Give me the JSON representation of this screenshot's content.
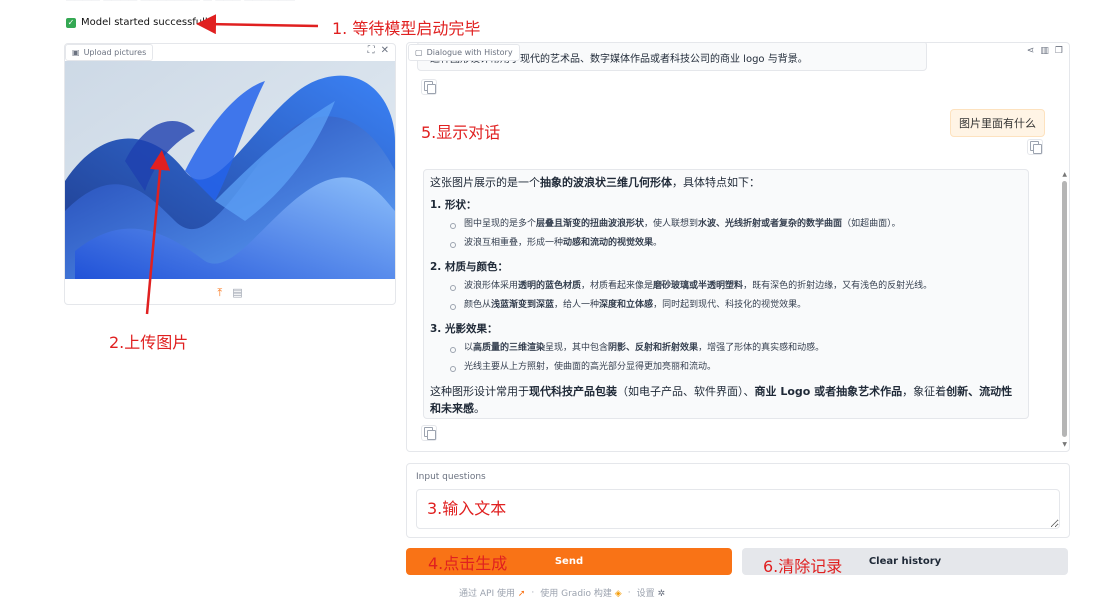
{
  "status": {
    "text": "Model started successfully"
  },
  "upload": {
    "label": "Upload pictures",
    "expand_icon": "fullscreen-icon",
    "close_icon": "close-icon"
  },
  "chat": {
    "label": "Dialogue with History",
    "prev_text": "这种图形设计常用于现代的艺术品、数字媒体作品或者科技公司的商业 logo 与背景。",
    "user_message": "图片里面有什么",
    "answer": {
      "intro_pre": "这张图片展示的是一个",
      "intro_bold": "抽象的波浪状三维几何形体",
      "intro_post": "，具体特点如下：",
      "sections": [
        {
          "title": "1. 形状：",
          "items": [
            [
              "图中呈现的是多个",
              "层叠且渐变的扭曲波浪形状",
              "，使人联想到",
              "水波、光线折射或者复杂的数学曲面",
              "（如超曲面）。"
            ],
            [
              "波浪互相重叠，形成一种",
              "动感和流动的视觉效果",
              "。",
              "",
              ""
            ]
          ]
        },
        {
          "title": "2. 材质与颜色：",
          "items": [
            [
              "波浪形体采用",
              "透明的蓝色材质",
              "，材质看起来像是",
              "磨砂玻璃或半透明塑料",
              "，既有深色的折射边缘，又有浅色的反射光线。"
            ],
            [
              "颜色从",
              "浅蓝渐变到深蓝",
              "，给人一种",
              "深度和立体感",
              "，同时起到现代、科技化的视觉效果。"
            ]
          ]
        },
        {
          "title": "3. 光影效果：",
          "items": [
            [
              "以",
              "高质量的三维渲染",
              "呈现，其中包含",
              "阴影、反射和折射效果",
              "，增强了形体的真实感和动感。"
            ],
            [
              "光线主要从上方照射，使曲面的高光部分显得更加亮丽和流动。",
              "",
              "",
              "",
              ""
            ]
          ]
        }
      ],
      "outro": [
        "这种图形设计常用于",
        "现代科技产品包装",
        "（如电子产品、软件界面）、",
        "商业 Logo 或者抽象艺术作品",
        "，象征着",
        "创新、流动性和未来感",
        "。"
      ]
    }
  },
  "input": {
    "label": "Input questions",
    "value": "",
    "placeholder": ""
  },
  "buttons": {
    "send": "Send",
    "clear": "Clear history"
  },
  "footer": {
    "api": "通过 API 使用",
    "built": "使用 Gradio 构建",
    "settings": "设置",
    "sep": "·"
  },
  "annotations": {
    "a1": "1. 等待模型启动完毕",
    "a2": "2.上传图片",
    "a3": "3.输入文本",
    "a4": "4.点击生成",
    "a5": "5.显示对话",
    "a6": "6.清除记录"
  },
  "colors": {
    "accent": "#f97316",
    "annotation": "#e02020",
    "success": "#34a853"
  }
}
